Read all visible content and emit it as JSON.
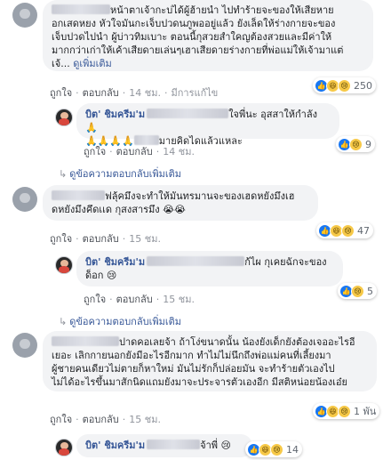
{
  "comments": [
    {
      "lines": [
        "หน้าตาเจ้ากะบ่ได้ผู้ฮ้ายนำ ไปทำร้ายจะของให้เสียหาย",
        "อกเสดหยง หัวใจมันกะเจ็บปวดนภูพออยู่แล้ว ยังเล็ดให้ร่างกายจะของ",
        "เจ็บปวดไปนำ ผู้บ่าวทิมเบาะ ตอนนี้กุสวยสำใคญต้องสวยและมีค่าให้",
        "มากกว่าเก่าให้เค้าเสียดายเล่นๆเฮาเสียดายร่างกายที่พ่อแม่ให้เจ้ามาแต่",
        "เจ้..."
      ],
      "see_more": "ดูเพิ่มเติม",
      "like": "ถูกใจ",
      "reply": "ตอบกลับ",
      "time": "14 ชม.",
      "edited": "มีการแก้ไข",
      "reaction_count": "250"
    },
    {
      "name": "บิต' ชิมครีม'ม",
      "line1": "ใจพี่นะ อุสสาให้กำลัง 🙏",
      "line2_emoji": "🙏🙏🙏🙏",
      "line2": "มายคิดไดแล้วแหละ",
      "like": "ถูกใจ",
      "reply": "ตอบกลับ",
      "time": "14 ชม.",
      "reaction_count": "9"
    },
    {
      "view_more_replies": "ดูข้อความตอบกลับเพิ่มเติม"
    },
    {
      "line1": "ฟลุ้คมึงจะทำให้มันทรมานจะของเฮดหยังมึงเฮ",
      "line2": "ดหยังมึงคึดเเด กุสงสารมึง 😭😭",
      "like": "ถูกใจ",
      "reply": "ตอบกลับ",
      "time": "15 ชม.",
      "reaction_count": "47"
    },
    {
      "name": "บิต' ชิมครีม'ม",
      "line1": "ก้ไผ กุเคยฉักจะของ",
      "line2": "ด็อก 😢",
      "like": "ถูกใจ",
      "reply": "ตอบกลับ",
      "time": "15 ชม.",
      "reaction_count": "5"
    },
    {
      "view_more_replies": "ดูข้อความตอบกลับเพิ่มเติม"
    },
    {
      "lines": [
        "ปาดคอเลยจ้า ถ้าโง่ขนาดนั้น น้องยังเด็กยังต้องเจออะไรอี",
        "เยอะ เลิกกายนอกยังมีอะไรอีกมาก ทำไม่ไม่นึกถึงพ่อแม่คนที่เลี้ยงมา",
        "ผู้ชายคนเดียวไม่ตายก็หาใหม่ มันไม่รักก็ปล่อยมัน จะทำร้ายตัวเองไป",
        "ไม่ได้อะไรขึ้นมาสักนิดแถมยังมาจะประจารตัวเองอีก มีสติหน่อยน้องเอ๋ย"
      ],
      "like": "ถูกใจ",
      "reply": "ตอบกลับ",
      "time": "15 ชม.",
      "reaction_count": "1 พัน"
    },
    {
      "name": "บิต' ชิมครีม'ม",
      "line1": "จ้าพี่ 😢",
      "reaction_count": "14"
    }
  ]
}
